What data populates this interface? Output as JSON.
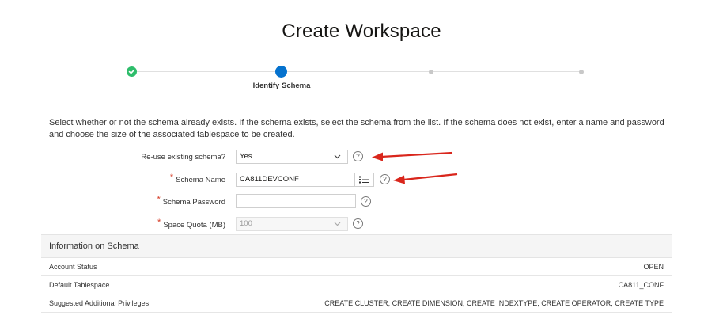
{
  "page": {
    "title": "Create Workspace"
  },
  "wizard": {
    "current_step_label": "Identify Schema"
  },
  "description": "Select whether or not the schema already exists. If the schema exists, select the schema from the list. If the schema does not exist, enter a name and password and choose the size of the associated tablespace to be created.",
  "form": {
    "reuse_schema": {
      "label": "Re-use existing schema?",
      "value": "Yes"
    },
    "schema_name": {
      "required_mark": "*",
      "label": "Schema Name",
      "value": "CA811DEVCONF"
    },
    "schema_password": {
      "required_mark": "*",
      "label": "Schema Password",
      "value": ""
    },
    "space_quota": {
      "required_mark": "*",
      "label": "Space Quota (MB)",
      "value": "100"
    },
    "help_glyph": "?"
  },
  "info": {
    "title": "Information on Schema",
    "rows": [
      {
        "key": "Account Status",
        "value": "OPEN"
      },
      {
        "key": "Default Tablespace",
        "value": "CA811_CONF"
      },
      {
        "key": "Suggested Additional Privileges",
        "value": "CREATE CLUSTER, CREATE DIMENSION, CREATE INDEXTYPE, CREATE OPERATOR, CREATE TYPE"
      }
    ]
  },
  "colors": {
    "step_complete": "#2ebd6b",
    "step_current": "#0572ce",
    "required": "#d63b25",
    "annotation_arrow": "#d9261c"
  },
  "icons": {
    "complete_step": "check-icon",
    "select": "chevron-down-icon",
    "lov": "list-icon",
    "help": "help-icon"
  }
}
